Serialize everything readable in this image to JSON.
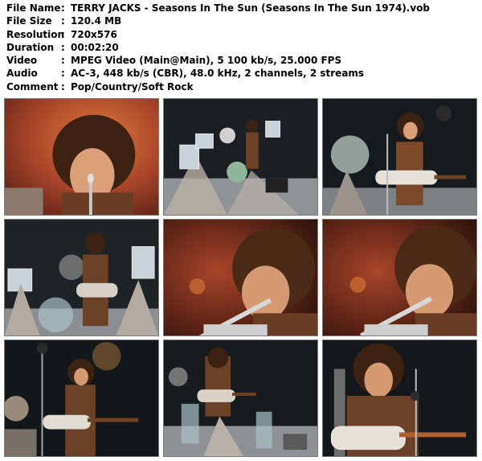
{
  "file_info": {
    "rows": [
      {
        "key": "File Name",
        "sep": ":",
        "value": "TERRY JACKS - Seasons In The Sun (Seasons In The Sun 1974).vob"
      },
      {
        "key": "File Size",
        "sep": ":",
        "value": "120.4 MB"
      },
      {
        "key": "Resolution",
        "sep": ":",
        "value": "720x576"
      },
      {
        "key": "Duration",
        "sep": ":",
        "value": "00:02:20"
      },
      {
        "key": "Video",
        "sep": ":",
        "value": "MPEG Video (Main@Main), 5 100 kb/s, 25.000 FPS"
      },
      {
        "key": "Audio",
        "sep": ":",
        "value": "AC-3, 448 kb/s (CBR), 48.0 kHz, 2 channels, 2 streams"
      },
      {
        "key": "Comment",
        "sep": ":",
        "value": "Pop/Country/Soft Rock"
      }
    ]
  },
  "thumbnails": {
    "count": 9,
    "columns": 3,
    "rows": 3
  },
  "colors": {
    "background": "#ffffff",
    "text": "#000000",
    "thumb_border": "#7a7a7a"
  }
}
